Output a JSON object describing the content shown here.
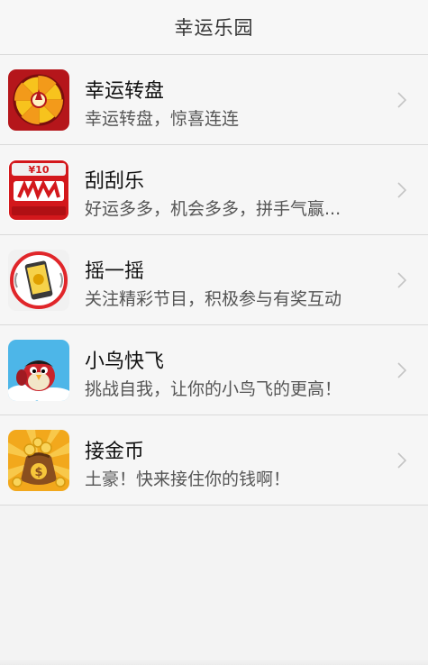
{
  "header": {
    "title": "幸运乐园"
  },
  "items": [
    {
      "title": "幸运转盘",
      "subtitle": "幸运转盘，惊喜连连",
      "icon": "wheel-icon"
    },
    {
      "title": "刮刮乐",
      "subtitle": "好运多多，机会多多，拼手气赢...",
      "icon": "scratch-card-icon"
    },
    {
      "title": "摇一摇",
      "subtitle": "关注精彩节目，积极参与有奖互动",
      "icon": "shake-phone-icon"
    },
    {
      "title": "小鸟快飞",
      "subtitle": "挑战自我，让你的小鸟飞的更高！",
      "icon": "bird-icon"
    },
    {
      "title": "接金币",
      "subtitle": "土豪！快来接住你的钱啊！",
      "icon": "coin-bag-icon"
    }
  ],
  "icon_text": {
    "scratch_top": "¥10"
  },
  "colors": {
    "header_bg": "#f7f7f7",
    "list_bg": "#f6f6f6",
    "divider": "#dadada",
    "title": "#111111",
    "subtitle": "#555555"
  }
}
